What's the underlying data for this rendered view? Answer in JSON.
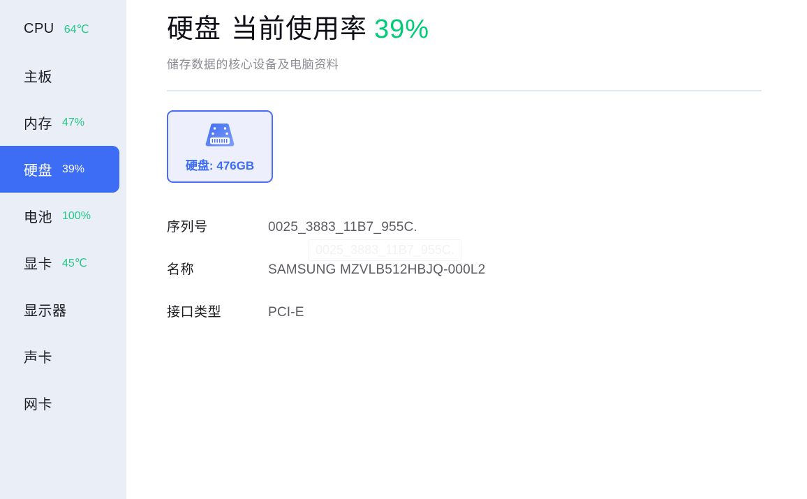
{
  "sidebar": {
    "items": [
      {
        "label": "CPU",
        "value": "64℃",
        "active": false,
        "name": "sidebar-item-cpu"
      },
      {
        "label": "主板",
        "value": "",
        "active": false,
        "name": "sidebar-item-motherboard"
      },
      {
        "label": "内存",
        "value": "47%",
        "active": false,
        "name": "sidebar-item-memory"
      },
      {
        "label": "硬盘",
        "value": "39%",
        "active": true,
        "name": "sidebar-item-disk"
      },
      {
        "label": "电池",
        "value": "100%",
        "active": false,
        "name": "sidebar-item-battery"
      },
      {
        "label": "显卡",
        "value": "45℃",
        "active": false,
        "name": "sidebar-item-gpu"
      },
      {
        "label": "显示器",
        "value": "",
        "active": false,
        "name": "sidebar-item-monitor"
      },
      {
        "label": "声卡",
        "value": "",
        "active": false,
        "name": "sidebar-item-soundcard"
      },
      {
        "label": "网卡",
        "value": "",
        "active": false,
        "name": "sidebar-item-networkcard"
      }
    ]
  },
  "header": {
    "device_name": "硬盘",
    "usage_label": "当前使用率",
    "usage_value": "39%",
    "subtitle": "储存数据的核心设备及电脑资料"
  },
  "device_card": {
    "icon": "hard-drive-icon",
    "label": "硬盘: 476GB"
  },
  "details": {
    "rows": [
      {
        "label": "序列号",
        "value": "0025_3883_11B7_955C.",
        "name": "detail-row-serial-number"
      },
      {
        "label": "名称",
        "value": "SAMSUNG MZVLB512HBJQ-000L2",
        "name": "detail-row-model-name"
      },
      {
        "label": "接口类型",
        "value": "PCI-E",
        "name": "detail-row-interface-type"
      }
    ],
    "tooltip_text": "0025_3883_11B7_955C."
  },
  "colors": {
    "sidebar_background": "#eaeef7",
    "active_item": "#3d6df5",
    "status_green": "#23c986",
    "usage_green": "#00cc77",
    "card_border": "#4a6cf7",
    "card_background": "#edf0fc",
    "divider": "#e2e7f0"
  }
}
